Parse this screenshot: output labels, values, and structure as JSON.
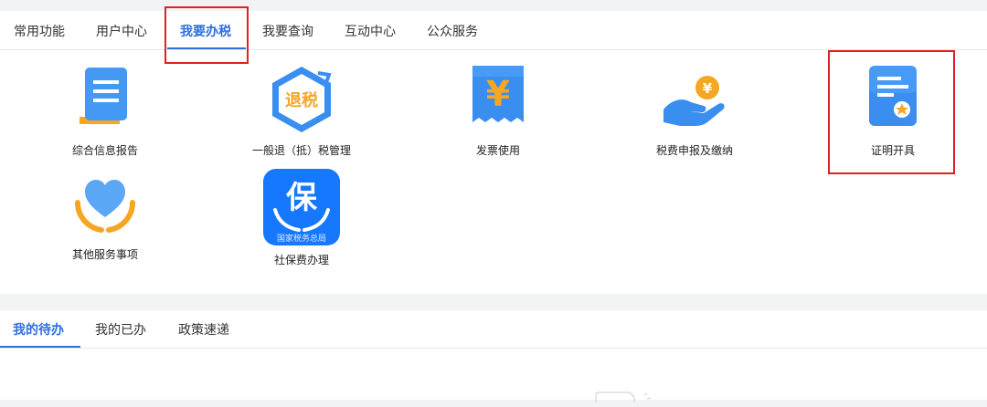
{
  "top_tabs": {
    "items": [
      "常用功能",
      "用户中心",
      "我要办税",
      "我要查询",
      "互动中心",
      "公众服务"
    ],
    "active_index": 2
  },
  "tiles": [
    {
      "label": "综合信息报告",
      "icon": "report-document-icon"
    },
    {
      "label": "一般退（抵）税管理",
      "icon": "tax-refund-hexagon-icon",
      "icon_text": "退税"
    },
    {
      "label": "发票使用",
      "icon": "invoice-yen-icon",
      "icon_text": "¥"
    },
    {
      "label": "税费申报及缴纳",
      "icon": "hand-coin-icon",
      "icon_text": "¥"
    },
    {
      "label": "证明开具",
      "icon": "certificate-icon"
    },
    {
      "label": "其他服务事项",
      "icon": "heart-hands-icon"
    },
    {
      "label": "社保费办理",
      "icon": "social-insurance-icon",
      "icon_text": "保",
      "icon_subtext": "国家税务总局"
    }
  ],
  "bottom_tabs": {
    "items": [
      "我的待办",
      "我的已办",
      "政策速递"
    ],
    "active_index": 0
  },
  "colors": {
    "accent": "#2f6fe0",
    "highlight_box": "#e02020",
    "icon_blue": "#3a8ef0",
    "icon_orange": "#f5a623"
  }
}
